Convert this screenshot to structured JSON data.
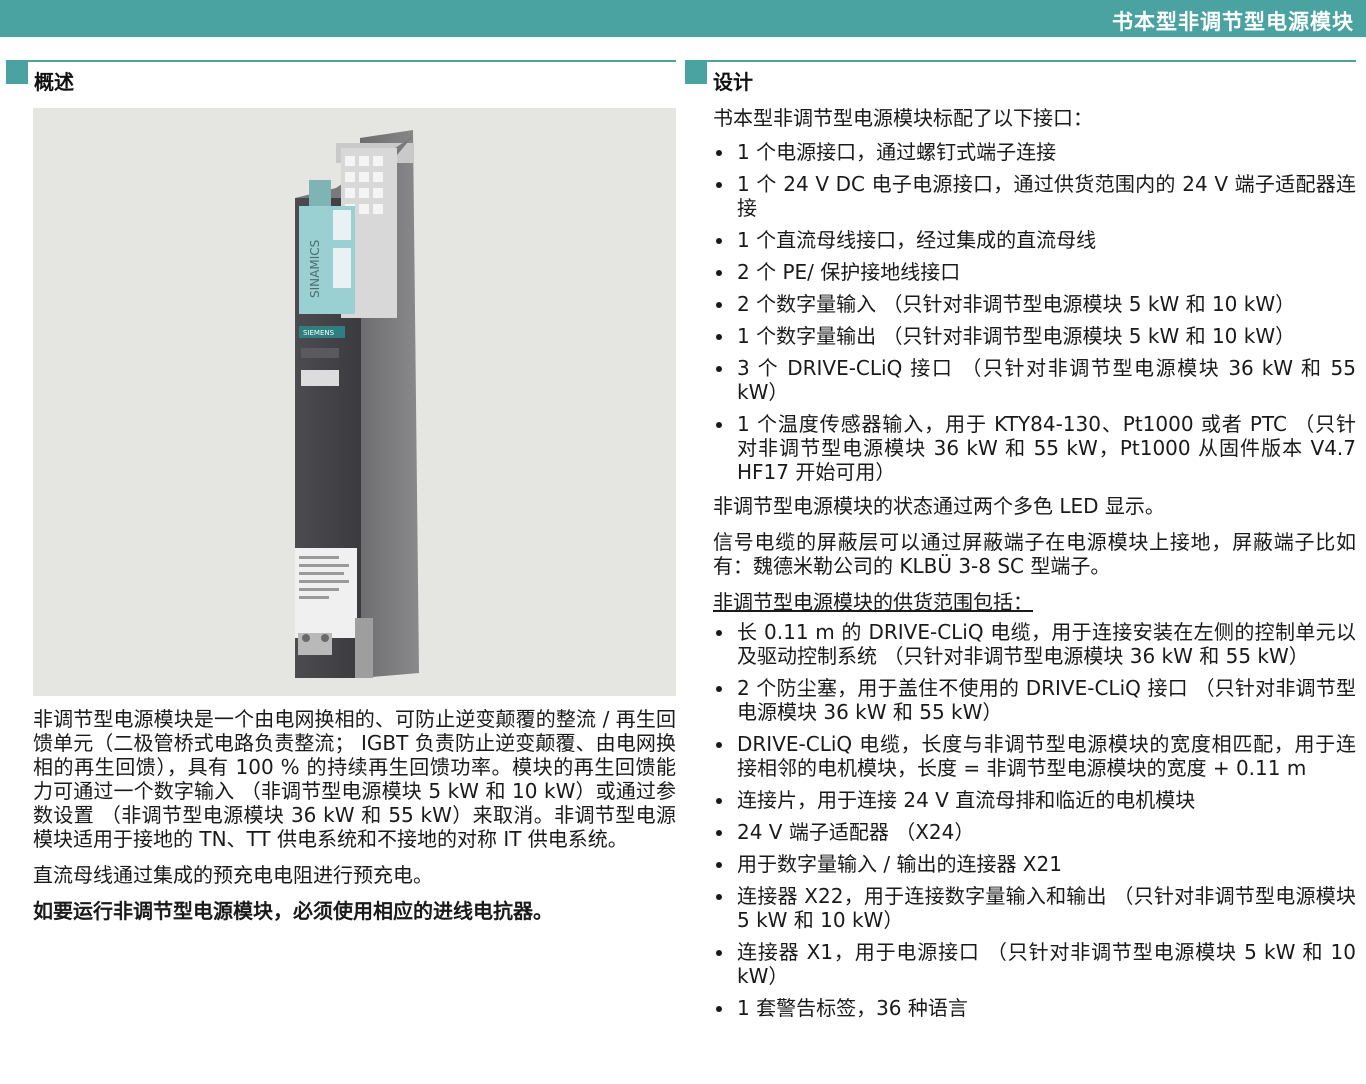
{
  "header": {
    "title": "书本型非调节型电源模块"
  },
  "left": {
    "heading": "概述",
    "image_alt": "SINAMICS 非调节型电源模块",
    "device_brand": "SINAMICS",
    "device_maker": "SIEMENS",
    "paragraphs": [
      "非调节型电源模块是一个由电网换相的、可防止逆变颠覆的整流 / 再生回馈单元（二极管桥式电路负责整流； IGBT 负责防止逆变颠覆、由电网换相的再生回馈），具有 100 % 的持续再生回馈功率。模块的再生回馈能力可通过一个数字输入 （非调节型电源模块 5 kW 和 10 kW）或通过参数设置 （非调节型电源模块 36 kW 和 55 kW）来取消。非调节型电源模块适用于接地的 TN、TT 供电系统和不接地的对称 IT 供电系统。",
      "直流母线通过集成的预充电电阻进行预充电。"
    ],
    "note_bold": "如要运行非调节型电源模块，必须使用相应的进线电抗器。"
  },
  "right": {
    "heading": "设计",
    "intro": "书本型非调节型电源模块标配了以下接口：",
    "interfaces": [
      "1 个电源接口，通过螺钉式端子连接",
      "1 个 24 V DC 电子电源接口，通过供货范围内的 24 V 端子适配器连接",
      "1 个直流母线接口，经过集成的直流母线",
      "2 个 PE/ 保护接地线接口",
      "2 个数字量输入 （只针对非调节型电源模块 5 kW 和 10 kW）",
      "1 个数字量输出 （只针对非调节型电源模块 5 kW 和 10 kW）",
      "3 个 DRIVE-CLiQ 接口 （只针对非调节型电源模块 36 kW 和 55 kW）",
      "1 个温度传感器输入，用于 KTY84-130、Pt1000 或者 PTC （只针对非调节型电源模块 36 kW 和 55 kW，Pt1000 从固件版本 V4.7 HF17 开始可用）"
    ],
    "status_text": "非调节型电源模块的状态通过两个多色 LED 显示。",
    "shield_text": "信号电缆的屏蔽层可以通过屏蔽端子在电源模块上接地，屏蔽端子比如有：魏德米勒公司的 KLBÜ 3-8 SC 型端子。",
    "scope_heading": "非调节型电源模块的供货范围包括：",
    "scope_items": [
      "长 0.11 m 的 DRIVE-CLiQ 电缆，用于连接安装在左侧的控制单元以及驱动控制系统 （只针对非调节型电源模块 36 kW 和 55 kW）",
      "2 个防尘塞，用于盖住不使用的 DRIVE-CLiQ 接口 （只针对非调节型电源模块 36 kW 和 55 kW）",
      "DRIVE-CLiQ 电缆，长度与非调节型电源模块的宽度相匹配，用于连接相邻的电机模块，长度 = 非调节型电源模块的宽度 + 0.11 m",
      "连接片，用于连接 24 V 直流母排和临近的电机模块",
      "24 V 端子适配器 （X24）",
      "用于数字量输入 / 输出的连接器 X21",
      "连接器 X22，用于连接数字量输入和输出 （只针对非调节型电源模块 5 kW 和 10 kW）",
      "连接器 X1，用于电源接口 （只针对非调节型电源模块 5 kW 和 10 kW）",
      "1 套警告标签，36 种语言"
    ]
  }
}
